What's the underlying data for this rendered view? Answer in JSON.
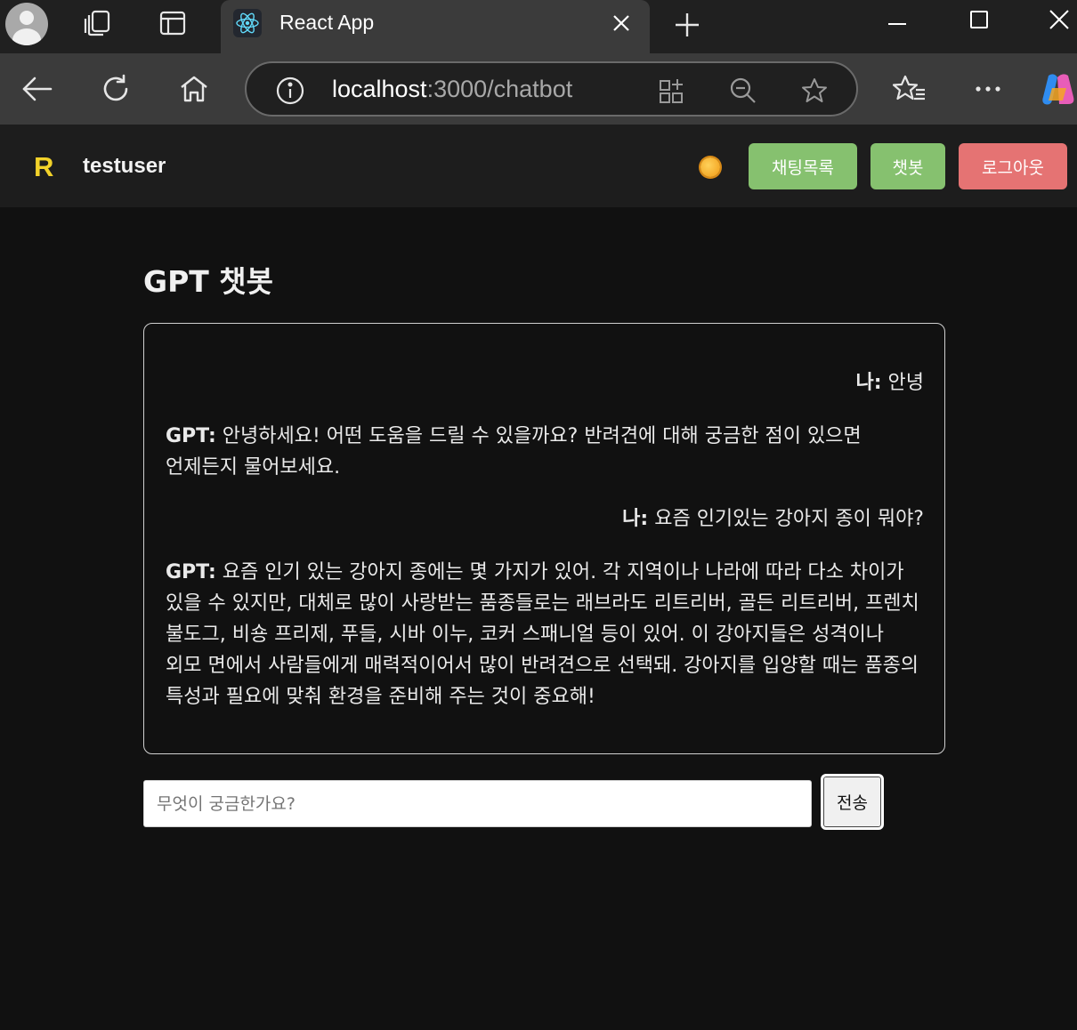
{
  "browser": {
    "tab_title": "React App",
    "url_host": "localhost",
    "url_path": ":3000/chatbot"
  },
  "navbar": {
    "logo": "R",
    "username": "testuser",
    "buttons": {
      "chat_list": "채팅목록",
      "chatbot": "챗봇",
      "logout": "로그아웃"
    },
    "colors": {
      "green": "#86c16f",
      "red": "#e57373",
      "logo": "#f2d22a"
    }
  },
  "page": {
    "title": "GPT 챗봇"
  },
  "messages": [
    {
      "sender": "user",
      "label": "나:",
      "text": "안녕"
    },
    {
      "sender": "gpt",
      "label": "GPT:",
      "text": "안녕하세요! 어떤 도움을 드릴 수 있을까요? 반려견에 대해 궁금한 점이 있으면 언제든지 물어보세요."
    },
    {
      "sender": "user",
      "label": "나:",
      "text": "요즘 인기있는 강아지 종이 뭐야?"
    },
    {
      "sender": "gpt",
      "label": "GPT:",
      "text": "요즘 인기 있는 강아지 종에는 몇 가지가 있어. 각 지역이나 나라에 따라 다소 차이가 있을 수 있지만, 대체로 많이 사랑받는 품종들로는 래브라도 리트리버, 골든 리트리버, 프렌치 불도그, 비숑 프리제, 푸들, 시바 이누, 코커 스패니얼 등이 있어. 이 강아지들은 성격이나 외모 면에서 사람들에게 매력적이어서 많이 반려견으로 선택돼. 강아지를 입양할 때는 품종의 특성과 필요에 맞춰 환경을 준비해 주는 것이 중요해!"
    }
  ],
  "input": {
    "placeholder": "무엇이 궁금한가요?",
    "value": "",
    "send_label": "전송"
  }
}
